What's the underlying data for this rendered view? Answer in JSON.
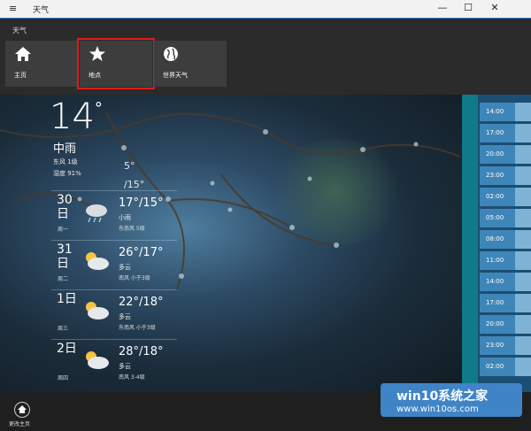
{
  "window": {
    "menu_icon": "hamburger-icon",
    "title": "天气",
    "minimize": "—",
    "maximize": "☐",
    "close": "✕"
  },
  "header": {
    "page_title": "天气",
    "tiles": [
      {
        "label": "主页",
        "icon": "home-icon"
      },
      {
        "label": "地点",
        "icon": "star-icon"
      },
      {
        "label": "世界天气",
        "icon": "globe-icon"
      }
    ]
  },
  "current": {
    "temp": "14",
    "unit": "°",
    "condition": "中雨",
    "wind": "东风 1级",
    "humidity": "湿度 91%",
    "high": "5°",
    "low": "/15°"
  },
  "forecast": [
    {
      "day": "30",
      "unit": "日",
      "weekday": "周一",
      "temps": "17°/15°",
      "desc": "小雨",
      "wind": "东南风 5级"
    },
    {
      "day": "31",
      "unit": "日",
      "weekday": "周二",
      "temps": "26°/17°",
      "desc": "多云",
      "wind": "南风 小于3级"
    },
    {
      "day": "1日",
      "unit": "",
      "weekday": "周三",
      "temps": "22°/18°",
      "desc": "多云",
      "wind": "东南风 小于3级"
    },
    {
      "day": "2日",
      "unit": "",
      "weekday": "周四",
      "temps": "28°/18°",
      "desc": "多云",
      "wind": "南风 3-4级"
    }
  ],
  "hourly": [
    "14:00",
    "17:00",
    "20:00",
    "23:00",
    "02:00",
    "05:00",
    "08:00",
    "11:00",
    "14:00",
    "17:00",
    "20:00",
    "23:00",
    "02:00"
  ],
  "bottom": {
    "home_label": "更改主页"
  },
  "watermark": {
    "line1": "win10系统之家",
    "line2": "www.win10os.com"
  }
}
